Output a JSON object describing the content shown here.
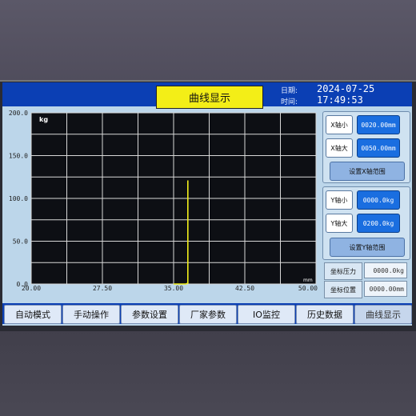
{
  "header": {
    "title": "曲线显示",
    "date_label": "日期:",
    "date_value": "2024-07-25",
    "time_label": "时间:",
    "time_value": "17:49:53"
  },
  "chart_data": {
    "type": "line",
    "unit_y": "kg",
    "unit_x": "mm",
    "y_ticks": [
      "200.0",
      "150.0",
      "100.0",
      "50.0",
      "0.0"
    ],
    "x_ticks": [
      "20.00",
      "27.50",
      "35.00",
      "42.50",
      "50.00"
    ],
    "xlim": [
      20,
      50
    ],
    "ylim": [
      0,
      200
    ],
    "grid": true,
    "series": [
      {
        "color": "#f2ee1a",
        "x": [
          35.0,
          35.2,
          36.0,
          36.3,
          36.5,
          36.5
        ],
        "y": [
          0,
          0,
          0,
          0,
          1,
          121
        ]
      }
    ]
  },
  "x_axis": {
    "min_label": "X轴小",
    "min_value": "0020.00mm",
    "max_label": "X轴大",
    "max_value": "0050.00mm",
    "set_label": "设置X轴范围"
  },
  "y_axis": {
    "min_label": "Y轴小",
    "min_value": "0000.0kg",
    "max_label": "Y轴大",
    "max_value": "0200.0kg",
    "set_label": "设置Y轴范围"
  },
  "info": {
    "pressure_label": "坐标压力",
    "pressure_value": "0000.0kg",
    "position_label": "坐标位置",
    "position_value": "0000.00mm"
  },
  "tabs": [
    "自动模式",
    "手动操作",
    "参数设置",
    "厂家参数",
    "IO监控",
    "历史数据",
    "曲线显示"
  ],
  "active_tab": "曲线显示"
}
